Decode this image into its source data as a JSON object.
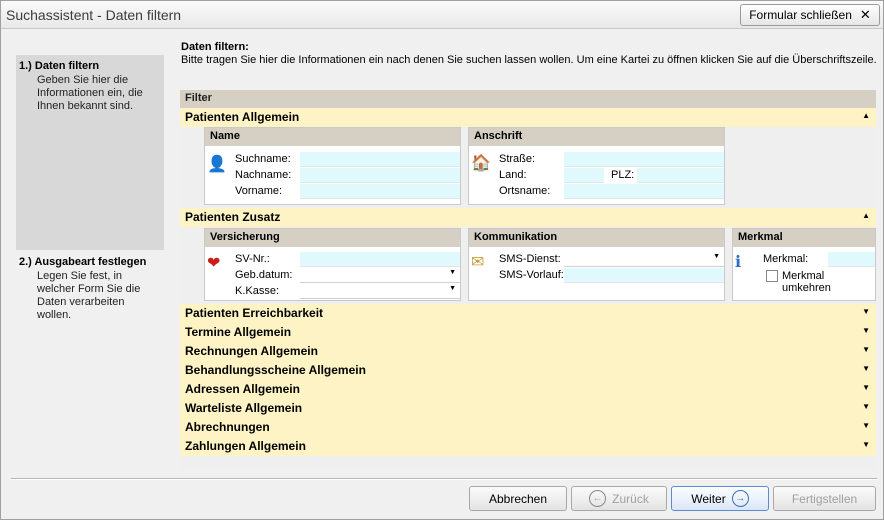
{
  "window": {
    "title": "Suchassistent - Daten filtern",
    "close_form_label": "Formular schließen"
  },
  "steps": [
    {
      "title": "1.) Daten filtern",
      "desc": "Geben Sie hier die Informationen ein, die Ihnen bekannt sind."
    },
    {
      "title": "2.) Ausgabeart festlegen",
      "desc": "Legen Sie fest, in welcher Form Sie die Daten verarbeiten wollen."
    }
  ],
  "main": {
    "header_title": "Daten filtern:",
    "header_desc": "Bitte tragen Sie hier die Informationen ein nach denen Sie suchen lassen wollen. Um eine Kartei zu öffnen klicken Sie auf die Überschriftszeile.",
    "filter_label": "Filter"
  },
  "sections": {
    "patienten_allgemein": {
      "label": "Patienten Allgemein",
      "name_group": {
        "title": "Name",
        "suchname": "Suchname:",
        "nachname": "Nachname:",
        "vorname": "Vorname:"
      },
      "anschrift_group": {
        "title": "Anschrift",
        "strasse": "Straße:",
        "land": "Land:",
        "plz": "PLZ:",
        "ortsname": "Ortsname:"
      }
    },
    "patienten_zusatz": {
      "label": "Patienten Zusatz",
      "versicherung_group": {
        "title": "Versicherung",
        "sv_nr": "SV-Nr.:",
        "geb_datum": "Geb.datum:",
        "k_kasse": "K.Kasse:"
      },
      "kommunikation_group": {
        "title": "Kommunikation",
        "sms_dienst": "SMS-Dienst:",
        "sms_vorlauf": "SMS-Vorlauf:"
      },
      "merkmal_group": {
        "title": "Merkmal",
        "merkmal": "Merkmal:",
        "umkehren": "Merkmal umkehren"
      }
    },
    "collapsed": [
      "Patienten Erreichbarkeit",
      "Termine Allgemein",
      "Rechnungen Allgemein",
      "Behandlungsscheine Allgemein",
      "Adressen Allgemein",
      "Warteliste Allgemein",
      "Abrechnungen",
      "Zahlungen Allgemein"
    ]
  },
  "footer": {
    "cancel": "Abbrechen",
    "back": "Zurück",
    "next": "Weiter",
    "finish": "Fertigstellen"
  },
  "icons": {
    "collapse": "collapse-arrow-icon",
    "expand": "expand-arrow-icon"
  }
}
